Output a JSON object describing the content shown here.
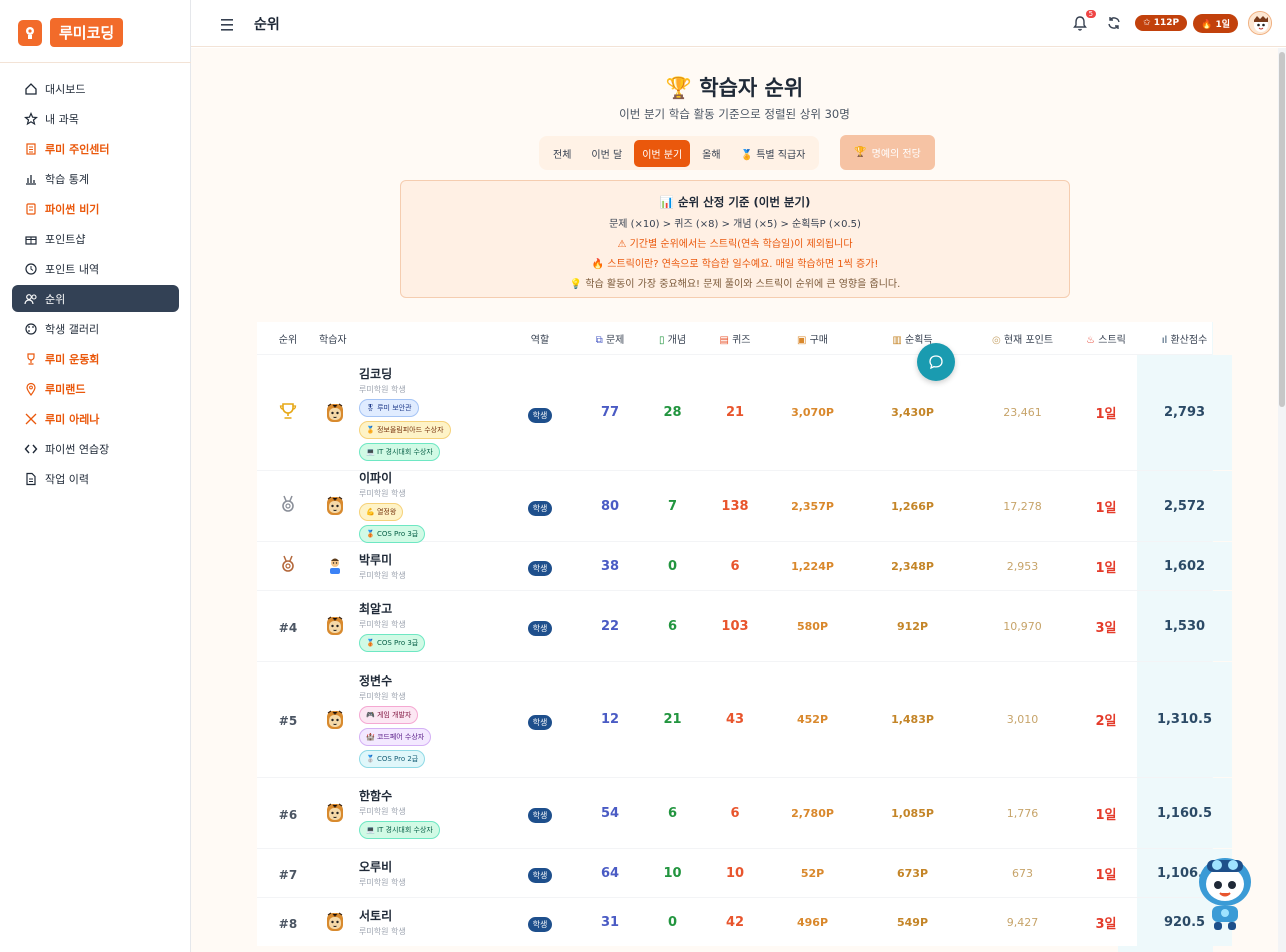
{
  "app": {
    "logo_text": "루미코딩",
    "page_title": "순위"
  },
  "topbar": {
    "notifications_count": "5",
    "points": "112P",
    "streak": "1일"
  },
  "sidebar": {
    "items": [
      {
        "label": "대시보드",
        "icon": "home-icon",
        "style": "normal"
      },
      {
        "label": "내 과목",
        "icon": "star-icon",
        "style": "normal"
      },
      {
        "label": "루미 주인센터",
        "icon": "building-icon",
        "style": "orange"
      },
      {
        "label": "학습 통계",
        "icon": "bar-chart-icon",
        "style": "normal"
      },
      {
        "label": "파이썬 비기",
        "icon": "scroll-icon",
        "style": "orange"
      },
      {
        "label": "포인트샵",
        "icon": "gift-icon",
        "style": "normal"
      },
      {
        "label": "포인트 내역",
        "icon": "history-icon",
        "style": "normal"
      },
      {
        "label": "순위",
        "icon": "users-icon",
        "style": "active"
      },
      {
        "label": "학생 갤러리",
        "icon": "palette-icon",
        "style": "normal"
      },
      {
        "label": "루미 운동회",
        "icon": "trophy-icon",
        "style": "orange"
      },
      {
        "label": "루미랜드",
        "icon": "map-pin-icon",
        "style": "orange"
      },
      {
        "label": "루미 아레나",
        "icon": "swords-icon",
        "style": "orange"
      },
      {
        "label": "파이썬 연습장",
        "icon": "code-icon",
        "style": "normal"
      },
      {
        "label": "작업 이력",
        "icon": "file-icon",
        "style": "normal"
      }
    ]
  },
  "hero": {
    "title": "학습자 순위",
    "subtitle": "이번 분기 학습 활동 기준으로 정렬된 상위 30명"
  },
  "tabs": [
    {
      "label": "전체",
      "selected": false
    },
    {
      "label": "이번 달",
      "selected": false
    },
    {
      "label": "이번 분기",
      "selected": true
    },
    {
      "label": "올해",
      "selected": false
    },
    {
      "label": "🏅 특별 직급자",
      "selected": false
    }
  ],
  "hall_of_fame": "명예의 전당",
  "criteria": {
    "title": "순위 산정 기준 (이번 분기)",
    "formula": "문제 (×10) > 퀴즈 (×8) > 개념 (×5) > 순획득P (×0.5)",
    "note1": "⚠ 기간별 순위에서는 스트릭(연속 학습일)이 제외됩니다",
    "note2": "🔥 스트릭이란? 연속으로 학습한 일수예요. 매일 학습하면 1씩 증가!",
    "note3": "💡 학습 활동이 가장 중요해요! 문제 풀이와 스트릭이 순위에 큰 영향을 줍니다."
  },
  "table": {
    "headers": {
      "rank": "순위",
      "user": "학습자",
      "role": "역할",
      "problems": "문제",
      "concepts": "개념",
      "quiz": "퀴즈",
      "purchase": "구매",
      "net_earned": "순획득",
      "current_points": "현재 포인트",
      "streak": "스트릭",
      "score": "환산점수"
    },
    "rows": [
      {
        "rank": "",
        "medal": "gold",
        "name": "김코딩",
        "sub": "루미학원 학생",
        "badges": [
          {
            "t": "🎖 루미 보안관",
            "c": "blue"
          },
          {
            "t": "🏅 정보올림피아드 수상자",
            "c": "yellow"
          },
          {
            "t": "💻 IT 경시대회 수상자",
            "c": "teal"
          }
        ],
        "role": "학생",
        "problems": "77",
        "concepts": "28",
        "quiz": "21",
        "purchase": "3,070P",
        "net": "3,430P",
        "points": "23,461",
        "streak": "1일",
        "score": "2,793",
        "h": 116
      },
      {
        "rank": "",
        "medal": "silver",
        "name": "이파이",
        "sub": "루미학원 학생",
        "badges": [
          {
            "t": "💪 열정왕",
            "c": "yellow"
          },
          {
            "t": "🥉 COS Pro 3급",
            "c": "teal"
          }
        ],
        "role": "학생",
        "problems": "80",
        "concepts": "7",
        "quiz": "138",
        "purchase": "2,357P",
        "net": "1,266P",
        "points": "17,278",
        "streak": "1일",
        "score": "2,572",
        "h": 71
      },
      {
        "rank": "",
        "medal": "bronze",
        "name": "박루미",
        "sub": "루미학원 학생",
        "badges": [],
        "role": "학생",
        "problems": "38",
        "concepts": "0",
        "quiz": "6",
        "purchase": "1,224P",
        "net": "2,348P",
        "points": "2,953",
        "streak": "1일",
        "score": "1,602",
        "h": 49
      },
      {
        "rank": "#4",
        "medal": "",
        "name": "최알고",
        "sub": "루미학원 학생",
        "badges": [
          {
            "t": "🥉 COS Pro 3급",
            "c": "teal"
          }
        ],
        "role": "학생",
        "problems": "22",
        "concepts": "6",
        "quiz": "103",
        "purchase": "580P",
        "net": "912P",
        "points": "10,970",
        "streak": "3일",
        "score": "1,530",
        "h": 71
      },
      {
        "rank": "#5",
        "medal": "",
        "name": "정변수",
        "sub": "루미학원 학생",
        "badges": [
          {
            "t": "🎮 게임 개발자",
            "c": "pink"
          },
          {
            "t": "🏰 코드페어 수상자",
            "c": "purple"
          },
          {
            "t": "🥈 COS Pro 2급",
            "c": "cyan"
          }
        ],
        "role": "학생",
        "problems": "12",
        "concepts": "21",
        "quiz": "43",
        "purchase": "452P",
        "net": "1,483P",
        "points": "3,010",
        "streak": "2일",
        "score": "1,310.5",
        "h": 116
      },
      {
        "rank": "#6",
        "medal": "",
        "name": "한함수",
        "sub": "루미학원 학생",
        "badges": [
          {
            "t": "💻 IT 경시대회 수상자",
            "c": "teal"
          }
        ],
        "role": "학생",
        "problems": "54",
        "concepts": "6",
        "quiz": "6",
        "purchase": "2,780P",
        "net": "1,085P",
        "points": "1,776",
        "streak": "1일",
        "score": "1,160.5",
        "h": 71
      },
      {
        "rank": "#7",
        "medal": "",
        "name": "오루비",
        "sub": "루미학원 학생",
        "badges": [],
        "role": "학생",
        "problems": "64",
        "concepts": "10",
        "quiz": "10",
        "purchase": "52P",
        "net": "673P",
        "points": "673",
        "streak": "1일",
        "score": "1,106.5",
        "h": 49
      },
      {
        "rank": "#8",
        "medal": "",
        "name": "서토리",
        "sub": "루미학원 학생",
        "badges": [],
        "role": "학생",
        "problems": "31",
        "concepts": "0",
        "quiz": "42",
        "purchase": "496P",
        "net": "549P",
        "points": "9,427",
        "streak": "3일",
        "score": "920.5",
        "h": 49
      }
    ]
  }
}
